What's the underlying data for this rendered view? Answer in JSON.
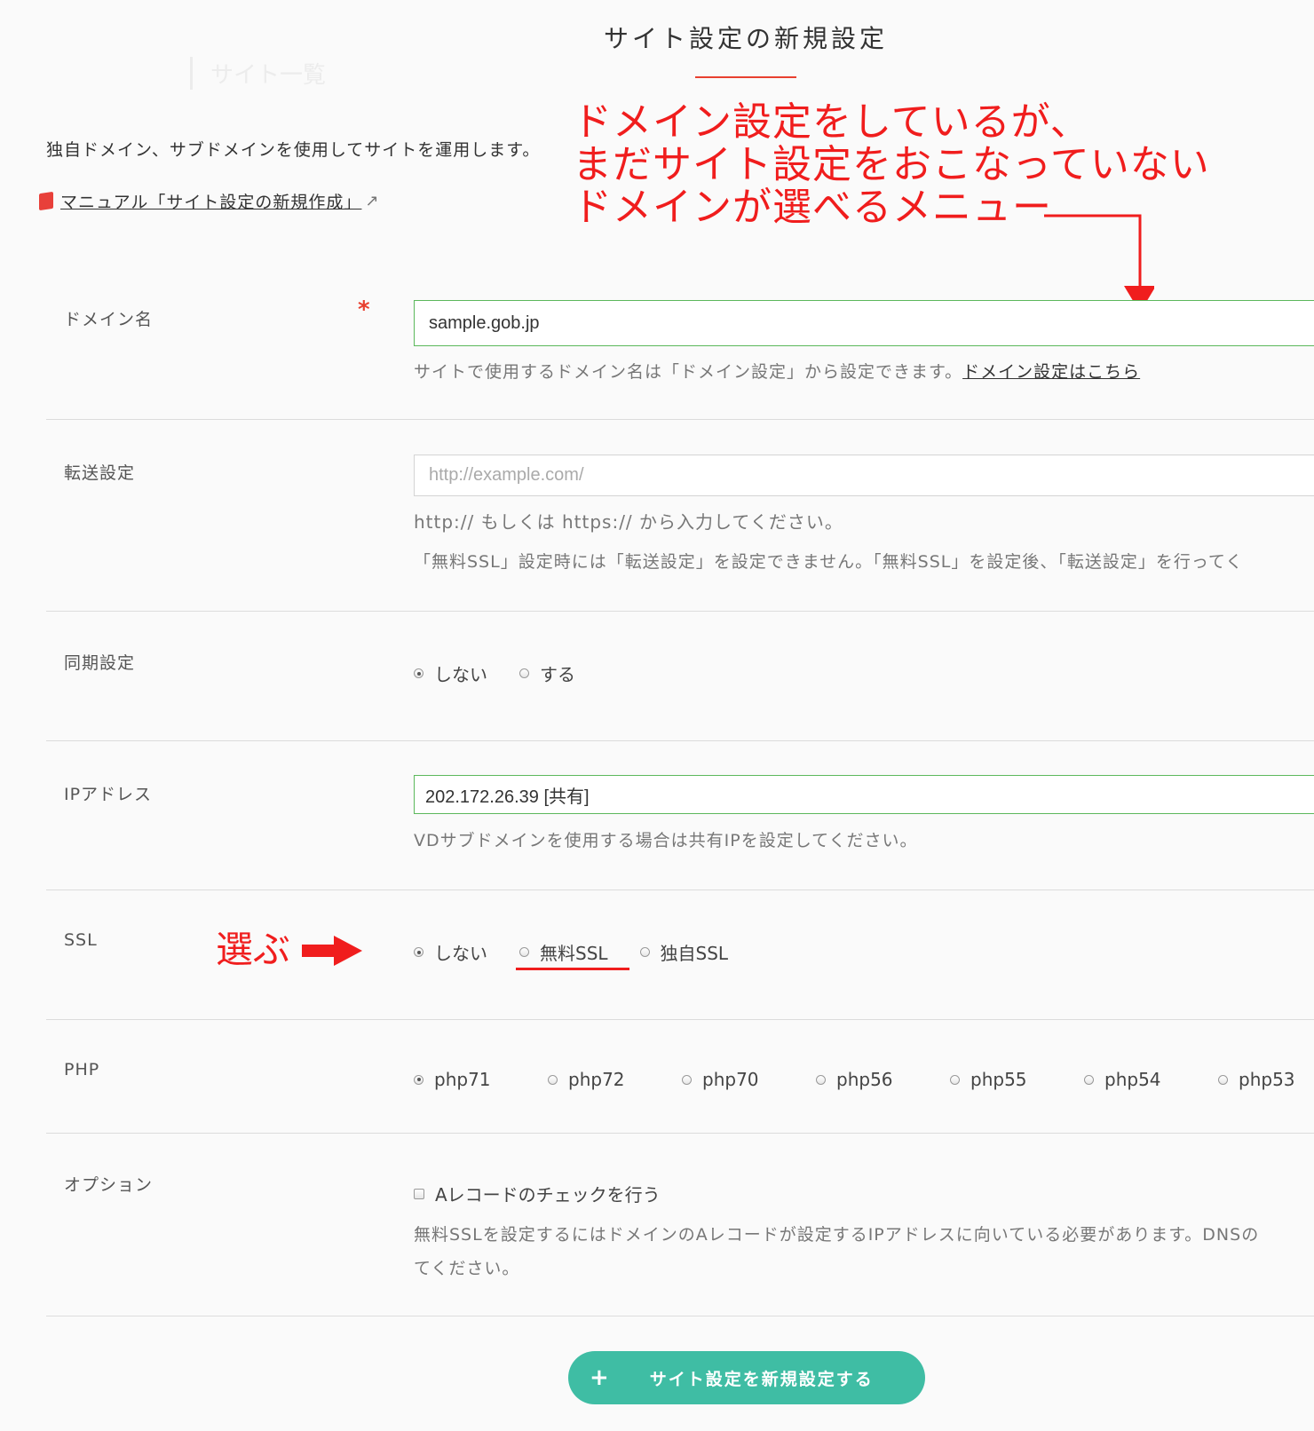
{
  "page": {
    "title": "サイト設定の新規設定",
    "ghost_heading": "サイト一覧",
    "intro": "独自ドメイン、サブドメインを使用してサイトを運用します。",
    "manual_link": "マニュアル「サイト設定の新規作成」"
  },
  "annotations": {
    "callout_line1": "ドメイン設定をしているが、",
    "callout_line2": "まだサイト設定をおこなっていない",
    "callout_line3": "ドメインが選べるメニュー",
    "select_label": "選ぶ",
    "color": "#f01d1d"
  },
  "form": {
    "domain": {
      "label": "ドメイン名",
      "required_mark": "*",
      "value": "sample.gob.jp",
      "help": "サイトで使用するドメイン名は「ドメイン設定」から設定できます。",
      "help_link": "ドメイン設定はこちら"
    },
    "redirect": {
      "label": "転送設定",
      "placeholder": "http://example.com/",
      "help1": "http:// もしくは https:// から入力してください。",
      "help2": "「無料SSL」設定時には「転送設定」を設定できません。「無料SSL」を設定後、「転送設定」を行ってく"
    },
    "sync": {
      "label": "同期設定",
      "options": [
        "しない",
        "する"
      ],
      "selected": "しない"
    },
    "ip": {
      "label": "IPアドレス",
      "value": "202.172.26.39 [共有]",
      "help": "VDサブドメインを使用する場合は共有IPを設定してください。"
    },
    "ssl": {
      "label": "SSL",
      "options": [
        "しない",
        "無料SSL",
        "独自SSL"
      ],
      "selected": "しない"
    },
    "php": {
      "label": "PHP",
      "options": [
        "php71",
        "php72",
        "php70",
        "php56",
        "php55",
        "php54",
        "php53"
      ],
      "selected": "php71"
    },
    "option": {
      "label": "オプション",
      "checkbox_label": "Aレコードのチェックを行う",
      "checked": false,
      "help1": "無料SSLを設定するにはドメインのAレコードが設定するIPアドレスに向いている必要があります。DNSの",
      "help2": "てください。"
    }
  },
  "submit": {
    "icon": "plus-icon",
    "label": "サイト設定を新規設定する",
    "color": "#3fbda4"
  },
  "colors": {
    "accent_red": "#e8402f",
    "field_border_valid": "#5cb85c"
  }
}
